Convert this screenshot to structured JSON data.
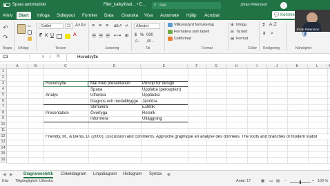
{
  "window": {
    "autosave_label": "Spara automatiskt",
    "file_name": "Filer_kalkylblad... • E...",
    "search_placeholder": "Sök",
    "user_name": "Jöran Petersson"
  },
  "tabs": [
    "Arkiv",
    "Start",
    "Infoga",
    "Sidlayout",
    "Formler",
    "Data",
    "Granska",
    "Visa",
    "Automate",
    "Hjälp",
    "Acrobat"
  ],
  "active_tab": "Start",
  "comments_button": "Kommentarer",
  "ribbon": {
    "font_name": "Calibri",
    "font_size": "11",
    "number_format": "Allmänt",
    "conditional_formatting": "Villkorsstyrd formatering",
    "format_as_table": "Formatera som tabell",
    "cell_styles": "Cellformat",
    "insert": "Infoga",
    "delete": "Ta bort",
    "format": "Format",
    "groups": [
      "Ångra",
      "Urklipp",
      "Tecken",
      "Justering",
      "Tal",
      "Format",
      "Celler",
      "Redigering",
      "Känslighet"
    ]
  },
  "formula_bar": {
    "name_box": "C3",
    "fx": "fx",
    "content": "Huvudsyfte"
  },
  "columns": [
    "A",
    "B",
    "C",
    "D",
    "E",
    "F",
    "G",
    "H",
    "I",
    "J",
    "K",
    "L",
    "M"
  ],
  "rows": [
    "1",
    "2",
    "3",
    "4",
    "5",
    "6",
    "7",
    "8",
    "9",
    "10",
    "11",
    "12",
    "13",
    "14",
    "15",
    "16"
  ],
  "table": {
    "headers": [
      "Huvudsyfte",
      "Mål med presentation",
      "Princip för design"
    ],
    "rows": [
      [
        "",
        "Spana",
        "Uppfatta (perception)"
      ],
      [
        "Analys",
        "Utforska",
        "Upptäcka"
      ],
      [
        "",
        "Diagnos och modellbygge",
        "Jämföra"
      ],
      [
        "",
        "Stimulera",
        "Estetik"
      ],
      [
        "Presentation",
        "Övertyga",
        "Retorik"
      ],
      [
        "",
        "Informera",
        "Utläggning"
      ]
    ]
  },
  "reference": "Friendly, M., & Denis, D. (2000). Discussion and comments. Approche graphique en analyse des données. The roots and branches of modern statist",
  "sheets": [
    "Diagramestetik",
    "Cirkeldiagram",
    "Linjediagram",
    "Histogram",
    "Syntax"
  ],
  "active_sheet": "Diagramestetik",
  "status": {
    "ready": "Klar",
    "accessibility": "Tillgänglighet: Utforska",
    "count": "Antal: 17",
    "zoom": "100 %"
  },
  "colors": {
    "excel_green": "#217346",
    "ribbon_bg": "#f3f3f3"
  }
}
